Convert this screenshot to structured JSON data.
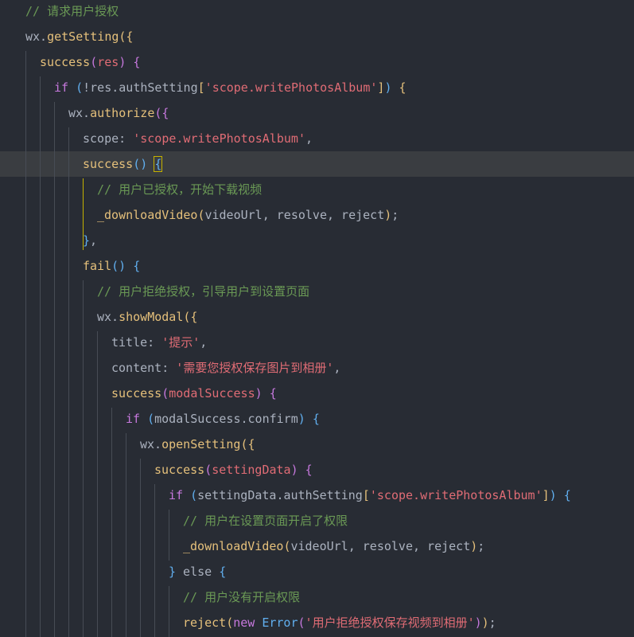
{
  "lines": [
    [
      [
        "comment",
        "// 请求用户授权"
      ]
    ],
    [
      [
        "obj",
        "wx."
      ],
      [
        "fn",
        "getSetting"
      ],
      [
        "b1",
        "({"
      ]
    ],
    [
      [
        "fn2",
        "success"
      ],
      [
        "b2",
        "("
      ],
      [
        "param",
        "res"
      ],
      [
        "b2",
        ")"
      ],
      [
        "plain",
        " "
      ],
      [
        "b2",
        "{"
      ]
    ],
    [
      [
        "kw",
        "if"
      ],
      [
        "plain",
        " "
      ],
      [
        "b3",
        "("
      ],
      [
        "plain",
        "!res.authSetting"
      ],
      [
        "b1",
        "["
      ],
      [
        "strq",
        "'"
      ],
      [
        "str",
        "scope.writePhotosAlbum"
      ],
      [
        "strq",
        "'"
      ],
      [
        "b1",
        "]"
      ],
      [
        "b3",
        ")"
      ],
      [
        "plain",
        " "
      ],
      [
        "b1",
        "{"
      ]
    ],
    [
      [
        "obj",
        "wx."
      ],
      [
        "fn",
        "authorize"
      ],
      [
        "b2",
        "({"
      ]
    ],
    [
      [
        "plain",
        "scope: "
      ],
      [
        "strq",
        "'"
      ],
      [
        "str",
        "scope.writePhotosAlbum"
      ],
      [
        "strq",
        "'"
      ],
      [
        "plain",
        ","
      ]
    ],
    [
      [
        "fn2",
        "success"
      ],
      [
        "b3",
        "()"
      ],
      [
        "plain",
        " "
      ],
      [
        "b3",
        "{"
      ]
    ],
    [
      [
        "comment",
        "// 用户已授权，开始下载视频"
      ]
    ],
    [
      [
        "fn2",
        "_downloadVideo"
      ],
      [
        "b1",
        "("
      ],
      [
        "plain",
        "videoUrl, resolve, reject"
      ],
      [
        "b1",
        ")"
      ],
      [
        "plain",
        ";"
      ]
    ],
    [
      [
        "b3",
        "}"
      ],
      [
        "plain",
        ","
      ]
    ],
    [
      [
        "fn2",
        "fail"
      ],
      [
        "b3",
        "()"
      ],
      [
        "plain",
        " "
      ],
      [
        "b3",
        "{"
      ]
    ],
    [
      [
        "comment",
        "// 用户拒绝授权，引导用户到设置页面"
      ]
    ],
    [
      [
        "obj",
        "wx."
      ],
      [
        "fn",
        "showModal"
      ],
      [
        "b1",
        "({"
      ]
    ],
    [
      [
        "plain",
        "title: "
      ],
      [
        "strq",
        "'"
      ],
      [
        "str",
        "提示"
      ],
      [
        "strq",
        "'"
      ],
      [
        "plain",
        ","
      ]
    ],
    [
      [
        "plain",
        "content: "
      ],
      [
        "strq",
        "'"
      ],
      [
        "str",
        "需要您授权保存图片到相册"
      ],
      [
        "strq",
        "'"
      ],
      [
        "plain",
        ","
      ]
    ],
    [
      [
        "fn2",
        "success"
      ],
      [
        "b2",
        "("
      ],
      [
        "param",
        "modalSuccess"
      ],
      [
        "b2",
        ")"
      ],
      [
        "plain",
        " "
      ],
      [
        "b2",
        "{"
      ]
    ],
    [
      [
        "kw",
        "if"
      ],
      [
        "plain",
        " "
      ],
      [
        "b3",
        "("
      ],
      [
        "plain",
        "modalSuccess.confirm"
      ],
      [
        "b3",
        ")"
      ],
      [
        "plain",
        " "
      ],
      [
        "b3",
        "{"
      ]
    ],
    [
      [
        "obj",
        "wx."
      ],
      [
        "fn",
        "openSetting"
      ],
      [
        "b1",
        "({"
      ]
    ],
    [
      [
        "fn2",
        "success"
      ],
      [
        "b2",
        "("
      ],
      [
        "param",
        "settingData"
      ],
      [
        "b2",
        ")"
      ],
      [
        "plain",
        " "
      ],
      [
        "b2",
        "{"
      ]
    ],
    [
      [
        "kw",
        "if"
      ],
      [
        "plain",
        " "
      ],
      [
        "b3",
        "("
      ],
      [
        "plain",
        "settingData.authSetting"
      ],
      [
        "b1",
        "["
      ],
      [
        "strq",
        "'"
      ],
      [
        "str",
        "scope.writePhotosAlbum"
      ],
      [
        "strq",
        "'"
      ],
      [
        "b1",
        "]"
      ],
      [
        "b3",
        ")"
      ],
      [
        "plain",
        " "
      ],
      [
        "b3",
        "{"
      ]
    ],
    [
      [
        "comment",
        "// 用户在设置页面开启了权限"
      ]
    ],
    [
      [
        "fn2",
        "_downloadVideo"
      ],
      [
        "b1",
        "("
      ],
      [
        "plain",
        "videoUrl, resolve, reject"
      ],
      [
        "b1",
        ")"
      ],
      [
        "plain",
        ";"
      ]
    ],
    [
      [
        "b3",
        "}"
      ],
      [
        "plain",
        " else "
      ],
      [
        "b3",
        "{"
      ]
    ],
    [
      [
        "comment",
        "// 用户没有开启权限"
      ]
    ],
    [
      [
        "fn2",
        "reject"
      ],
      [
        "b1",
        "("
      ],
      [
        "kw",
        "new"
      ],
      [
        "plain",
        " "
      ],
      [
        "err",
        "Error"
      ],
      [
        "b2",
        "("
      ],
      [
        "strq",
        "'"
      ],
      [
        "str",
        "用户拒绝授权保存视频到相册"
      ],
      [
        "strq",
        "'"
      ],
      [
        "b2",
        ")"
      ],
      [
        "b1",
        ")"
      ],
      [
        "plain",
        ";"
      ]
    ]
  ],
  "colors": {
    "background": "#282c34",
    "active_line": "#3a3d41",
    "comment": "#6a9955",
    "string": "#e06c75",
    "keyword": "#c678dd",
    "function": "#e5c07b"
  }
}
